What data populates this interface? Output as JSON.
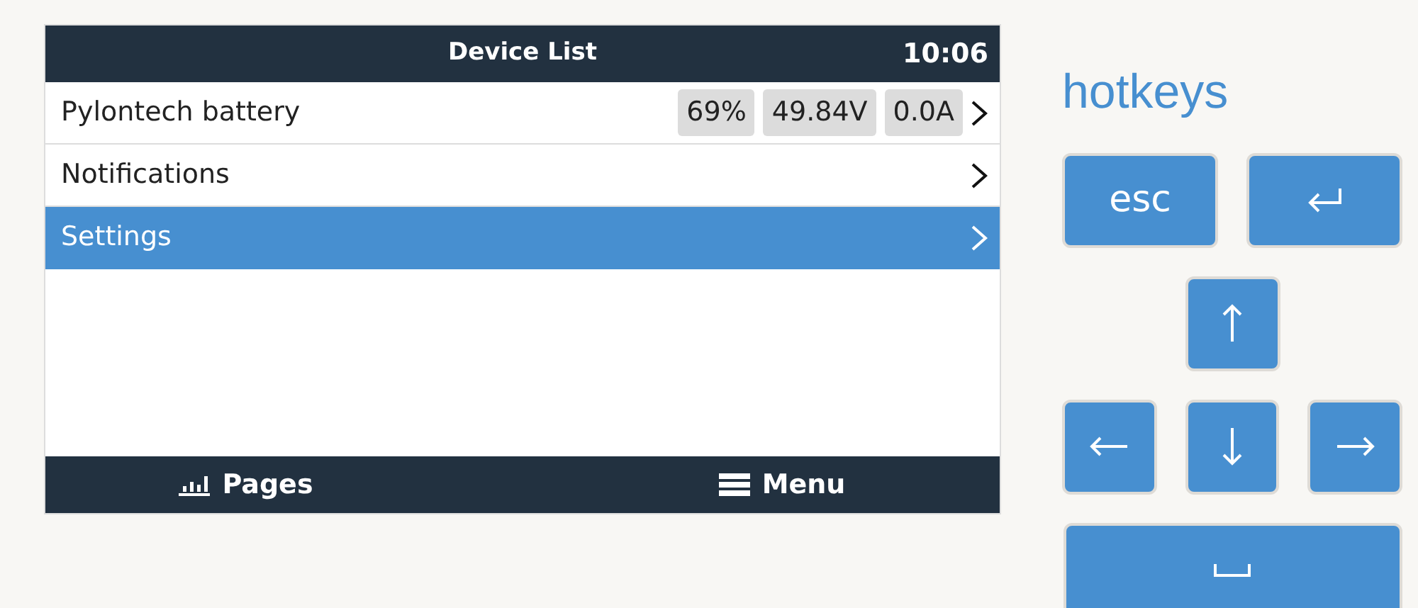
{
  "screen": {
    "title": "Device List",
    "clock": "10:06",
    "items": [
      {
        "label": "Pylontech battery",
        "values": [
          "69%",
          "49.84V",
          "0.0A"
        ],
        "selected": false
      },
      {
        "label": "Notifications",
        "selected": false
      },
      {
        "label": "Settings",
        "selected": true
      }
    ],
    "footer": [
      {
        "kind": "pages",
        "label": "Pages"
      },
      {
        "kind": "menu",
        "label": "Menu"
      }
    ]
  },
  "hotkeys": {
    "title": "hotkeys",
    "rows": [
      [
        {
          "kind": "text",
          "label": "esc"
        },
        {
          "kind": "enter"
        }
      ],
      [
        {
          "kind": "up"
        }
      ],
      [
        {
          "kind": "left"
        },
        {
          "kind": "down"
        },
        {
          "kind": "right"
        }
      ],
      [
        {
          "kind": "space"
        }
      ]
    ]
  }
}
